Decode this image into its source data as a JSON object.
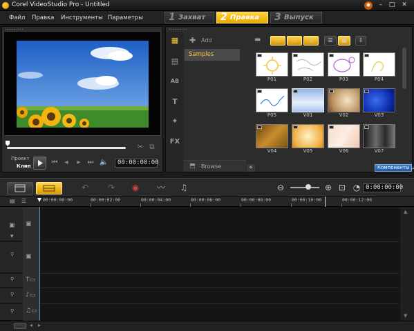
{
  "app": {
    "title": "Corel VideoStudio Pro - Untitled"
  },
  "menu": [
    "Файл",
    "Правка",
    "Инструменты",
    "Параметры"
  ],
  "steps": [
    {
      "num": "1",
      "label": "Захват"
    },
    {
      "num": "2",
      "label": "Правка"
    },
    {
      "num": "3",
      "label": "Выпуск"
    }
  ],
  "player": {
    "project_label": "Проект",
    "clip_label": "Клип",
    "timecode": "00:00:00:00"
  },
  "library": {
    "add_label": "Add",
    "folder": "Samples",
    "browse_label": "Browse",
    "components_label": "Компоненты",
    "thumbs": [
      "P01",
      "P02",
      "P03",
      "P04",
      "P05",
      "V01",
      "V02",
      "V03",
      "V04",
      "V05",
      "V06",
      "V07"
    ]
  },
  "timeline": {
    "timecode": "0:00:00:00",
    "ruler": [
      "00:00:00:00",
      "00:00:02:00",
      "00:00:04:00",
      "00:00:06:00",
      "00:00:08:00",
      "00:00:10:00",
      "00:00:12:00"
    ]
  }
}
